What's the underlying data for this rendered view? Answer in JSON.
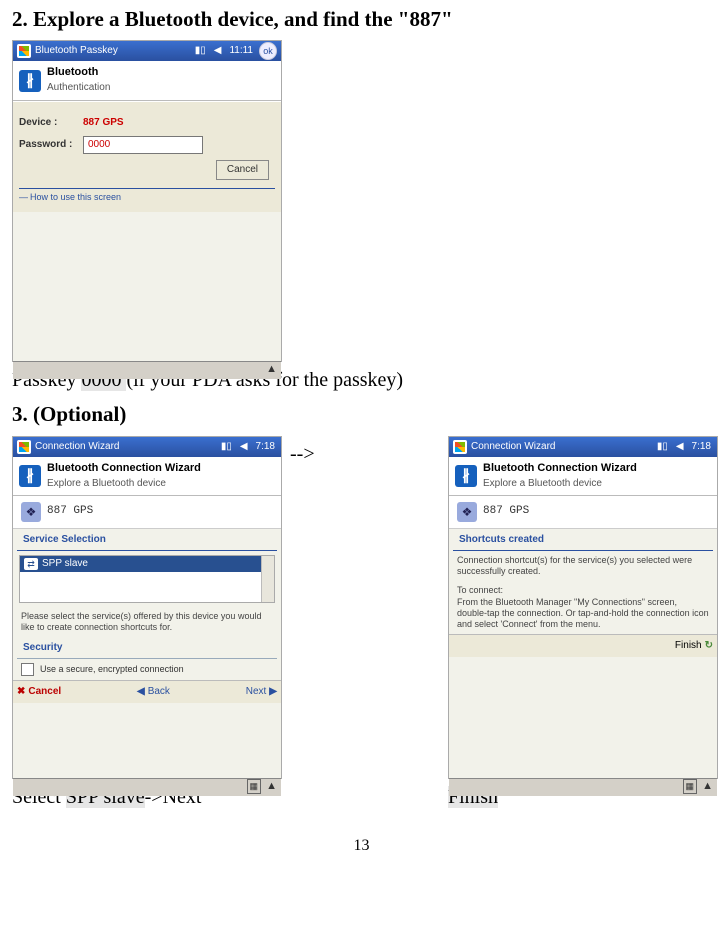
{
  "headings": {
    "step2": "2. Explore a Bluetooth device, and find the \"887\"",
    "step3": "3. (Optional)"
  },
  "passkey_screen": {
    "titlebar": {
      "title": "Bluetooth Passkey",
      "signal": "▮▯",
      "speaker": "◀",
      "time": "11:11",
      "ok": "ok"
    },
    "header": {
      "title": "Bluetooth",
      "subtitle": "Authentication"
    },
    "device_label": "Device   :",
    "device_value": "887 GPS",
    "password_label": "Password :",
    "password_value": "0000",
    "cancel": "Cancel",
    "howto": "How to use this screen",
    "sip_sym": "▲"
  },
  "passkey_caption": {
    "pre": "Passkey ",
    "hl": "0000 ",
    "post": "(if your PDA asks for the passkey)"
  },
  "wizard_a": {
    "titlebar": {
      "title": "Connection Wizard",
      "signal": "▮▯",
      "speaker": "◀",
      "time": "7:18"
    },
    "header": {
      "title": "Bluetooth Connection Wizard",
      "subtitle": "Explore a Bluetooth device"
    },
    "device": "887 GPS",
    "sec_service": "Service Selection",
    "service_item": "SPP slave",
    "note": "Please select the service(s) offered by this device you would like to create connection shortcuts for.",
    "sec_security": "Security",
    "sec_checkbox": "Use a secure, encrypted connection",
    "footer": {
      "cancel": "Cancel",
      "back": "Back",
      "next": "Next"
    },
    "sip_kb": "▦",
    "sip_sym": "▲"
  },
  "wizard_b": {
    "titlebar": {
      "title": "Connection Wizard",
      "signal": "▮▯",
      "speaker": "◀",
      "time": "7:18"
    },
    "header": {
      "title": "Bluetooth Connection Wizard",
      "subtitle": "Explore a Bluetooth device"
    },
    "device": "887 GPS",
    "sec_shortcuts": "Shortcuts created",
    "note1": "Connection shortcut(s) for the service(s) you selected were successfully created.",
    "note2": "To connect:\nFrom the Bluetooth Manager \"My Connections\" screen, double-tap the connection. Or tap-and-hold the connection icon and select 'Connect' from the menu.",
    "footer": {
      "finish": "Finish"
    },
    "sip_kb": "▦",
    "sip_sym": "▲"
  },
  "arrow_between": "-->",
  "caption_a": {
    "pre": "Select ",
    "hl": "SPP slave",
    "mid": "->",
    "post": "Next"
  },
  "caption_b": {
    "hl": "Finish"
  },
  "page_number": "13"
}
